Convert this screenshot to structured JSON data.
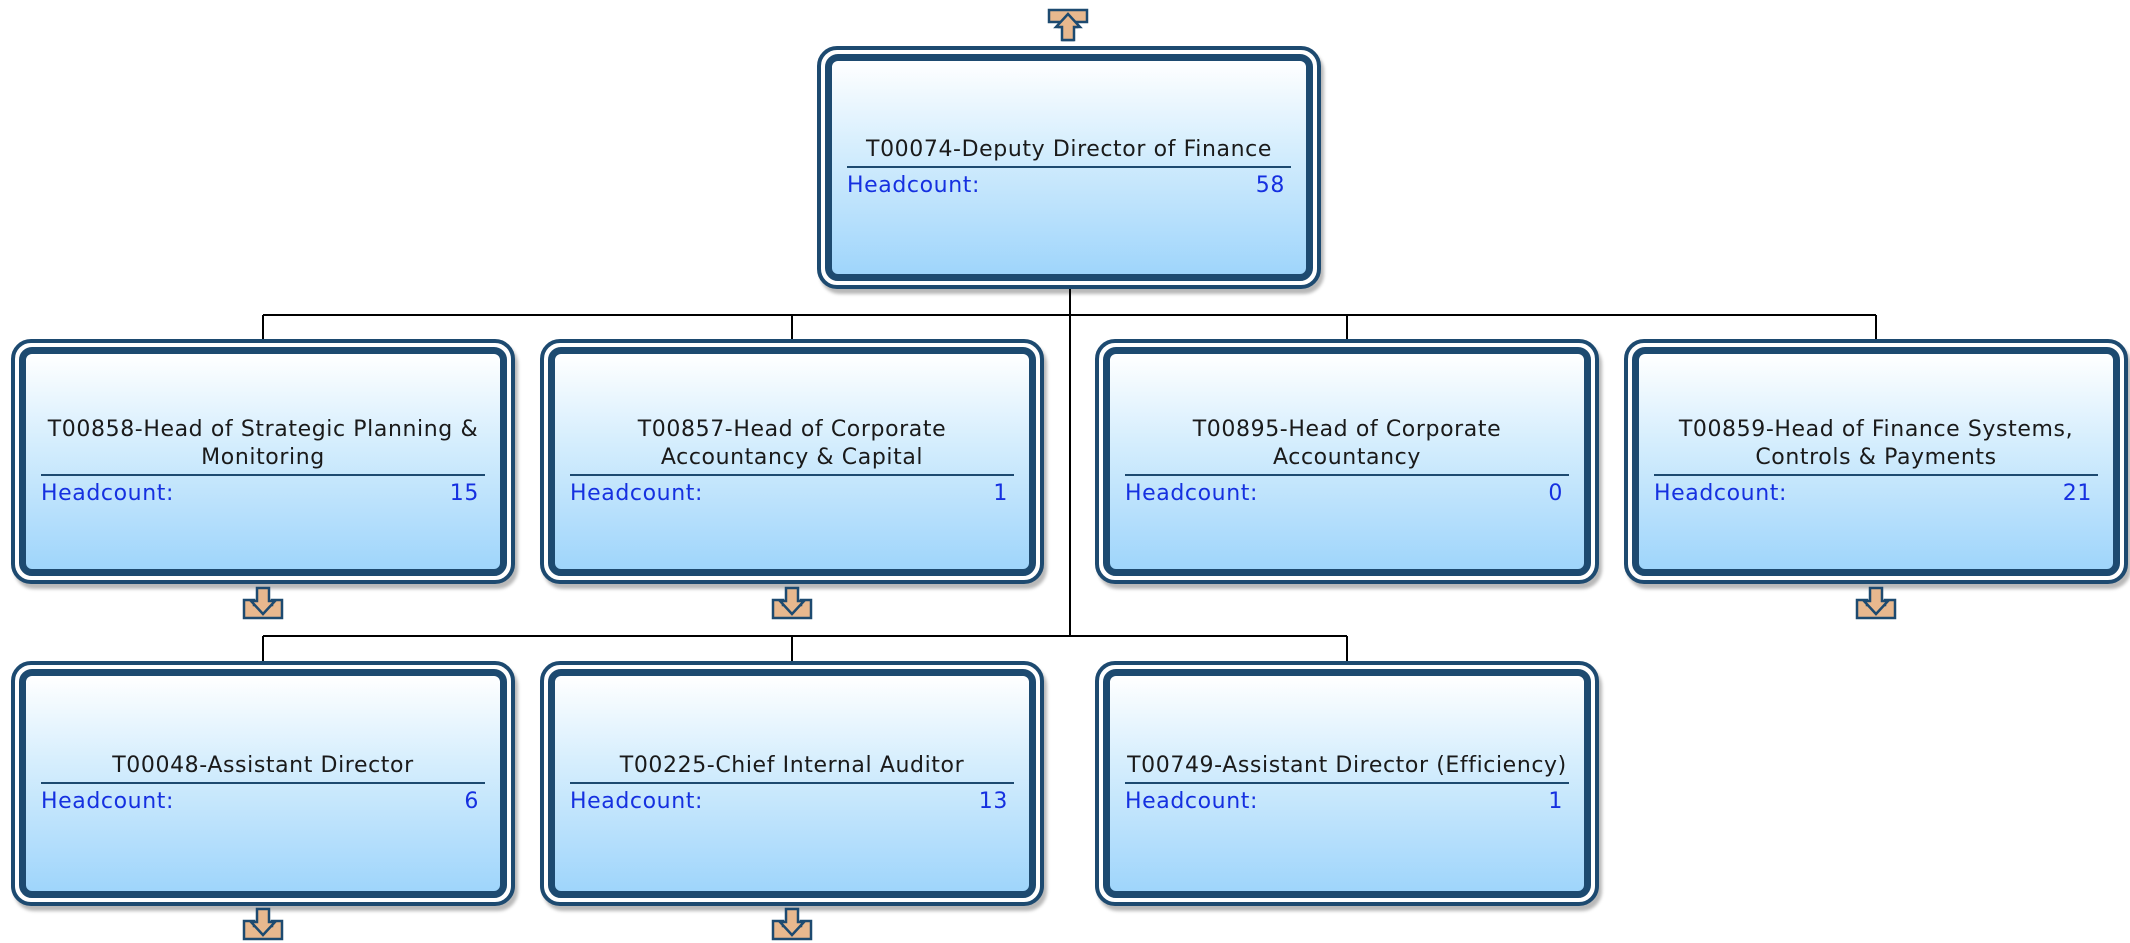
{
  "colors": {
    "frame": "#1d4a70",
    "stat_text": "#1530e0",
    "title_text": "#1a1a1a",
    "expander_fill": "#e8b88e"
  },
  "root": {
    "title": "T00074-Deputy Director of Finance",
    "stat_label": "Headcount:",
    "stat_value": "58",
    "expander_icon": "collapse-up-icon"
  },
  "row1": [
    {
      "title": "T00858-Head of Strategic Planning & Monitoring",
      "stat_label": "Headcount:",
      "stat_value": "15",
      "expander_icon": "expand-down-icon"
    },
    {
      "title": "T00857-Head of Corporate Accountancy & Capital",
      "stat_label": "Headcount:",
      "stat_value": "1",
      "expander_icon": "expand-down-icon"
    },
    {
      "title": "T00895-Head of Corporate Accountancy",
      "stat_label": "Headcount:",
      "stat_value": "0"
    },
    {
      "title": "T00859-Head of Finance Systems, Controls & Payments",
      "stat_label": "Headcount:",
      "stat_value": "21",
      "expander_icon": "expand-down-icon"
    }
  ],
  "row2": [
    {
      "title": "T00048-Assistant Director",
      "stat_label": "Headcount:",
      "stat_value": "6",
      "expander_icon": "expand-down-icon"
    },
    {
      "title": "T00225-Chief Internal Auditor",
      "stat_label": "Headcount:",
      "stat_value": "13",
      "expander_icon": "expand-down-icon"
    },
    {
      "title": "T00749-Assistant Director (Efficiency)",
      "stat_label": "Headcount:",
      "stat_value": "1"
    }
  ]
}
